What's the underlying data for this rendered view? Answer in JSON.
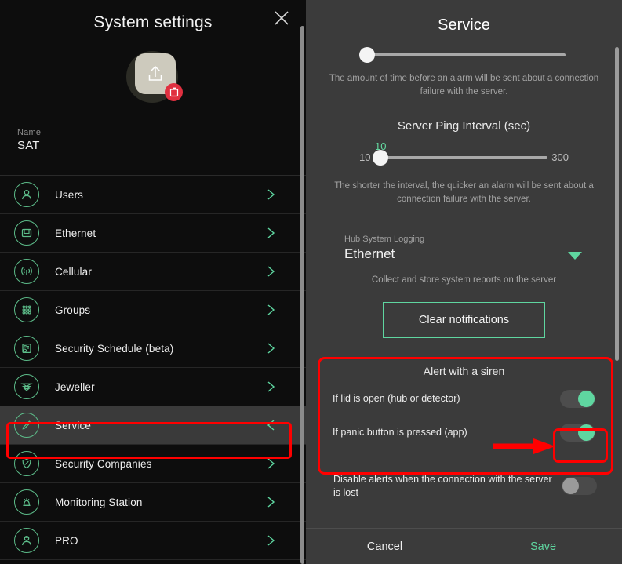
{
  "left": {
    "title": "System settings",
    "close_icon": "close-icon",
    "avatar": {
      "upload_icon": "upload-icon",
      "delete_icon": "trash-icon"
    },
    "name_field": {
      "label": "Name",
      "value": "SAT"
    },
    "items": [
      {
        "label": "Users",
        "icon": "user-circle-icon",
        "chevron": "chevron-right-icon",
        "selected": false
      },
      {
        "label": "Ethernet",
        "icon": "ethernet-port-icon",
        "chevron": "chevron-right-icon",
        "selected": false
      },
      {
        "label": "Cellular",
        "icon": "cellular-signal-icon",
        "chevron": "chevron-right-icon",
        "selected": false
      },
      {
        "label": "Groups",
        "icon": "grid-dots-icon",
        "chevron": "chevron-right-icon",
        "selected": false
      },
      {
        "label": "Security Schedule (beta)",
        "icon": "schedule-document-icon",
        "chevron": "chevron-right-icon",
        "selected": false
      },
      {
        "label": "Jeweller",
        "icon": "jeweller-signal-icon",
        "chevron": "chevron-right-icon",
        "selected": false
      },
      {
        "label": "Service",
        "icon": "pencil-icon",
        "chevron": "chevron-left-icon",
        "selected": true
      },
      {
        "label": "Security Companies",
        "icon": "shield-icon",
        "chevron": "chevron-right-icon",
        "selected": false
      },
      {
        "label": "Monitoring Station",
        "icon": "siren-icon",
        "chevron": "chevron-right-icon",
        "selected": false
      },
      {
        "label": "PRO",
        "icon": "user-pro-icon",
        "chevron": "chevron-right-icon",
        "selected": false
      }
    ]
  },
  "right": {
    "title": "Service",
    "top_slider": {
      "hint": "The amount of time before an alarm will be sent about a connection failure with the server."
    },
    "ping": {
      "title": "Server Ping Interval (sec)",
      "min": "10",
      "max": "300",
      "current": "10",
      "hint": "The shorter the interval, the quicker an alarm will be sent about a connection failure with the server."
    },
    "logging": {
      "label": "Hub System Logging",
      "value": "Ethernet",
      "caret_icon": "chevron-down-icon",
      "hint": "Collect and store system reports on the server"
    },
    "clear_notifications_label": "Clear notifications",
    "siren": {
      "title": "Alert with a siren",
      "rows": [
        {
          "label": "If lid is open (hub or detector)",
          "state": "on"
        },
        {
          "label": "If panic button is pressed (app)",
          "state": "on"
        }
      ]
    },
    "disable_alerts": {
      "label": "Disable alerts when the connection with the server is lost",
      "state": "off"
    },
    "footer": {
      "cancel": "Cancel",
      "save": "Save"
    }
  },
  "colors": {
    "accent_green": "#5fd6a0",
    "icon_green": "#5dbd8a",
    "annotation_red": "#ff0000",
    "left_bg": "#0d0d0d",
    "right_bg": "#3b3b3b",
    "selected_row": "#3a3a3a"
  }
}
